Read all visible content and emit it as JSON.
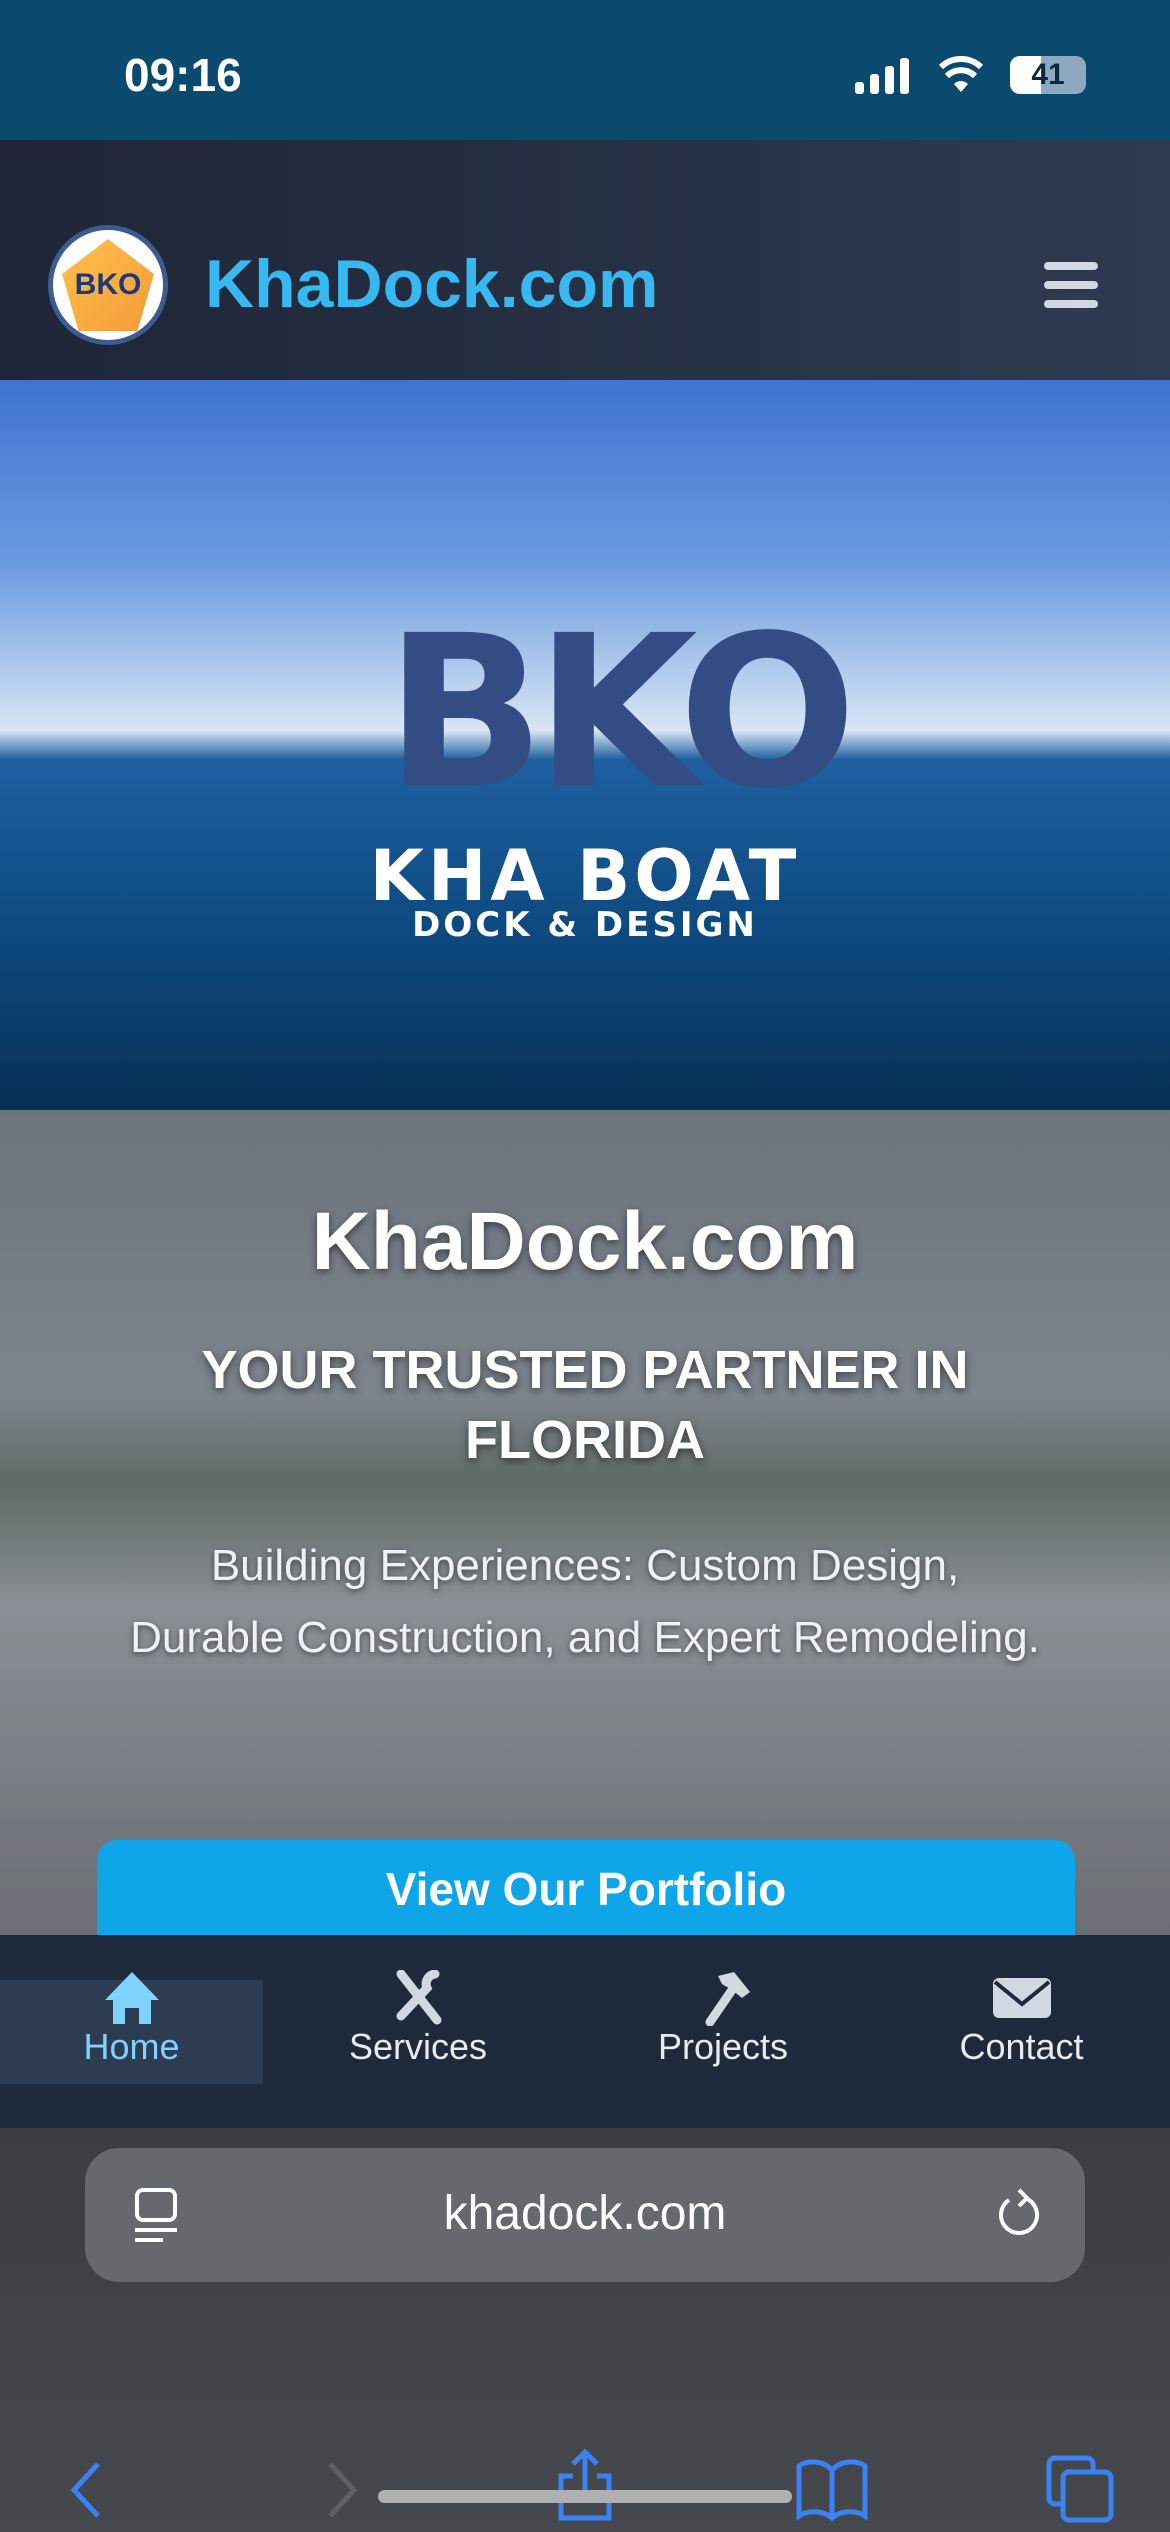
{
  "status_bar": {
    "time": "09:16",
    "battery": "41",
    "battery_level_percent": 41
  },
  "header": {
    "logo_text": "BKO",
    "brand": "KhaDock.com",
    "menu_icon": "hamburger-icon"
  },
  "hero": {
    "logo_letters": "BKO",
    "logo_title": "KHA BOAT",
    "logo_subtitle": "DOCK & DESIGN"
  },
  "intro": {
    "title": "KhaDock.com",
    "subtitle": "YOUR TRUSTED PARTNER IN FLORIDA",
    "description": "Building Experiences: Custom Design, Durable Construction, and Expert Remodeling.",
    "cta": "View Our Portfolio"
  },
  "bottom_nav": {
    "items": [
      {
        "label": "Home",
        "icon": "home-icon",
        "active": true
      },
      {
        "label": "Services",
        "icon": "tools-icon"
      },
      {
        "label": "Projects",
        "icon": "hammer-icon"
      },
      {
        "label": "Contact",
        "icon": "envelope-icon"
      }
    ]
  },
  "browser": {
    "url": "khadock.com"
  },
  "colors": {
    "brand": "#35b9f0",
    "cta": "#0ea5e9",
    "nav_bg": "#1e293b",
    "active": "#7dd3fc",
    "safari_accent": "#3b82f6"
  }
}
